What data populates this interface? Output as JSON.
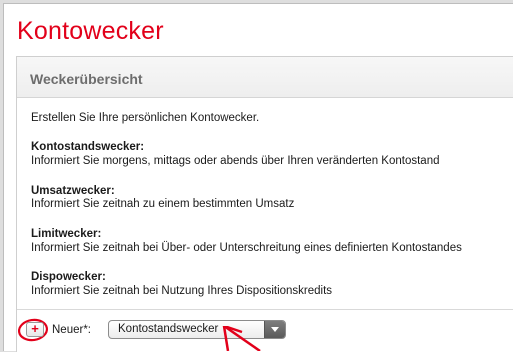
{
  "page": {
    "title": "Kontowecker"
  },
  "panel": {
    "title": "Weckerübersicht",
    "intro": "Erstellen Sie Ihre persönlichen Kontowecker.",
    "sections": [
      {
        "heading": "Kontostandswecker:",
        "text": "Informiert Sie morgens, mittags oder abends über Ihren veränderten Kontostand"
      },
      {
        "heading": "Umsatzwecker:",
        "text": "Informiert Sie zeitnah zu einem bestimmten Umsatz"
      },
      {
        "heading": "Limitwecker:",
        "text": "Informiert Sie zeitnah bei Über- oder Unterschreitung eines definierten Kontostandes"
      },
      {
        "heading": "Dispowecker:",
        "text": "Informiert Sie zeitnah bei Nutzung Ihres Dispositionskredits"
      }
    ]
  },
  "footer": {
    "add_icon": "plus-icon",
    "add_label": "+",
    "new_label": "Neuer*:",
    "select_value": "Kontostandswecker"
  },
  "colors": {
    "brand": "#e2001a",
    "annotation": "#e2001a"
  }
}
